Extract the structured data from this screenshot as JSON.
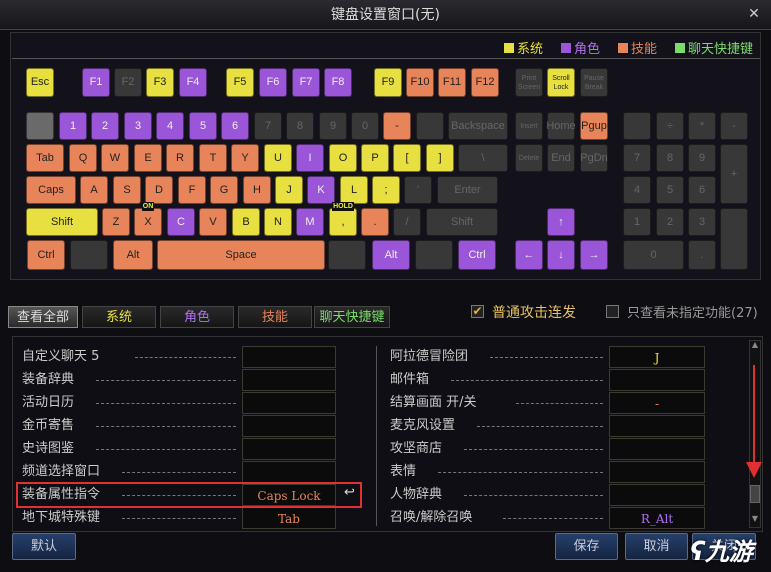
{
  "title": "键盘设置窗口(无)",
  "colors": {
    "system": "#e8e040",
    "character": "#9a55d8",
    "skill": "#e8845a",
    "chat": "#7adc6a",
    "none": "#383838"
  },
  "legend": [
    {
      "label": "系统",
      "color": "#e8e040",
      "text": "#e8e040"
    },
    {
      "label": "角色",
      "color": "#9a55d8",
      "text": "#b070f0"
    },
    {
      "label": "技能",
      "color": "#e8845a",
      "text": "#e8845a"
    },
    {
      "label": "聊天快捷键",
      "color": "#7adc6a",
      "text": "#7adc6a"
    }
  ],
  "keys": [
    [
      "Esc",
      "sys"
    ],
    [
      "F1",
      "char"
    ],
    [
      "F2",
      "none"
    ],
    [
      "F3",
      "sys"
    ],
    [
      "F4",
      "char"
    ],
    [
      "F5",
      "sys"
    ],
    [
      "F6",
      "char"
    ],
    [
      "F7",
      "char"
    ],
    [
      "F8",
      "char"
    ],
    [
      "F9",
      "sys"
    ],
    [
      "F10",
      "skill"
    ],
    [
      "F11",
      "skill"
    ],
    [
      "F12",
      "skill"
    ],
    [
      "Print Screen",
      "none"
    ],
    [
      "Scroll Lock",
      "sys"
    ],
    [
      "Pause Break",
      "none"
    ],
    [
      "",
      "light"
    ],
    [
      "1",
      "char"
    ],
    [
      "2",
      "char"
    ],
    [
      "3",
      "char"
    ],
    [
      "4",
      "char"
    ],
    [
      "5",
      "char"
    ],
    [
      "6",
      "char"
    ],
    [
      "7",
      "none"
    ],
    [
      "8",
      "none"
    ],
    [
      "9",
      "none"
    ],
    [
      "0",
      "none"
    ],
    [
      "-",
      "skill"
    ],
    [
      "",
      "none"
    ],
    [
      "Backspace",
      "none"
    ],
    [
      "Insert",
      "none"
    ],
    [
      "Home",
      "none"
    ],
    [
      "Pgup",
      "skill"
    ],
    [
      "",
      "none"
    ],
    [
      "÷",
      "none"
    ],
    [
      "*",
      "none"
    ],
    [
      "-",
      "none"
    ],
    [
      "Tab",
      "skill"
    ],
    [
      "Q",
      "skill"
    ],
    [
      "W",
      "skill"
    ],
    [
      "E",
      "skill"
    ],
    [
      "R",
      "skill"
    ],
    [
      "T",
      "skill"
    ],
    [
      "Y",
      "skill"
    ],
    [
      "U",
      "sys"
    ],
    [
      "I",
      "char"
    ],
    [
      "O",
      "sys"
    ],
    [
      "P",
      "sys"
    ],
    [
      "[",
      "sys"
    ],
    [
      "]",
      "sys"
    ],
    [
      "\\",
      "none"
    ],
    [
      "Delete",
      "none"
    ],
    [
      "End",
      "none"
    ],
    [
      "PgDn",
      "none"
    ],
    [
      "7",
      "none"
    ],
    [
      "8",
      "none"
    ],
    [
      "9",
      "none"
    ],
    [
      "+",
      "none"
    ],
    [
      "Caps",
      "skill"
    ],
    [
      "A",
      "skill"
    ],
    [
      "S",
      "skill"
    ],
    [
      "D",
      "skill"
    ],
    [
      "F",
      "skill"
    ],
    [
      "G",
      "skill"
    ],
    [
      "H",
      "skill"
    ],
    [
      "J",
      "sys"
    ],
    [
      "K",
      "char"
    ],
    [
      "L",
      "sys"
    ],
    [
      ";",
      "sys"
    ],
    [
      "'",
      "none"
    ],
    [
      "Enter",
      "none"
    ],
    [
      "4",
      "none"
    ],
    [
      "5",
      "none"
    ],
    [
      "6",
      "none"
    ],
    [
      "Shift",
      "sys"
    ],
    [
      "Z",
      "skill"
    ],
    [
      "X",
      "skill"
    ],
    [
      "C",
      "char"
    ],
    [
      "V",
      "skill"
    ],
    [
      "B",
      "sys"
    ],
    [
      "N",
      "sys"
    ],
    [
      "M",
      "char"
    ],
    [
      ",",
      "sys"
    ],
    [
      ".",
      "skill"
    ],
    [
      "/",
      "none"
    ],
    [
      "Shift",
      "none"
    ],
    [
      "↑",
      "char"
    ],
    [
      "1",
      "none"
    ],
    [
      "2",
      "none"
    ],
    [
      "3",
      "none"
    ],
    [
      "",
      "none"
    ],
    [
      "Ctrl",
      "skill"
    ],
    [
      "",
      "none"
    ],
    [
      "Alt",
      "skill"
    ],
    [
      "Space",
      "skill"
    ],
    [
      "",
      "none"
    ],
    [
      "Alt",
      "char"
    ],
    [
      "",
      "none"
    ],
    [
      "Ctrl",
      "char"
    ],
    [
      "←",
      "char"
    ],
    [
      "↓",
      "char"
    ],
    [
      "→",
      "char"
    ],
    [
      "0",
      "none"
    ],
    [
      ".",
      "none"
    ]
  ],
  "badges": {
    "X": "ON",
    "comma": "HOLD"
  },
  "tabs": [
    {
      "label": "查看全部",
      "color": "#ddd"
    },
    {
      "label": "系统",
      "color": "#e8e040"
    },
    {
      "label": "角色",
      "color": "#b070f0"
    },
    {
      "label": "技能",
      "color": "#e8845a"
    },
    {
      "label": "聊天快捷键",
      "color": "#7adc6a"
    }
  ],
  "options": {
    "auto_attack": {
      "label": "普通攻击连发",
      "checked": true
    },
    "unassigned_only": {
      "label": "只查看未指定功能(27)",
      "checked": false
    }
  },
  "left_list": [
    {
      "label": "自定义聊天 5",
      "key": ""
    },
    {
      "label": "装备辞典",
      "key": ""
    },
    {
      "label": "活动日历",
      "key": ""
    },
    {
      "label": "金币寄售",
      "key": ""
    },
    {
      "label": "史诗图鉴",
      "key": ""
    },
    {
      "label": "频道选择窗口",
      "key": ""
    },
    {
      "label": "装备属性指令",
      "key": "Caps Lock",
      "key_color": "#e8845a",
      "highlighted": true
    },
    {
      "label": "地下城特殊键",
      "key": "Tab",
      "key_color": "#e8845a"
    }
  ],
  "right_list": [
    {
      "label": "阿拉德冒险团",
      "key": "J",
      "key_color": "#e8e040"
    },
    {
      "label": "邮件箱",
      "key": ""
    },
    {
      "label": "结算画面 开/关",
      "key": "-",
      "key_color": "#e8845a"
    },
    {
      "label": "麦克风设置",
      "key": ""
    },
    {
      "label": "攻坚商店",
      "key": ""
    },
    {
      "label": "表情",
      "key": ""
    },
    {
      "label": "人物辞典",
      "key": ""
    },
    {
      "label": "召唤/解除召唤",
      "key": "R_Alt",
      "key_color": "#b070f0"
    }
  ],
  "buttons": {
    "default": "默认",
    "save": "保存",
    "cancel": "取消",
    "close": "关闭"
  },
  "watermark": "九游"
}
